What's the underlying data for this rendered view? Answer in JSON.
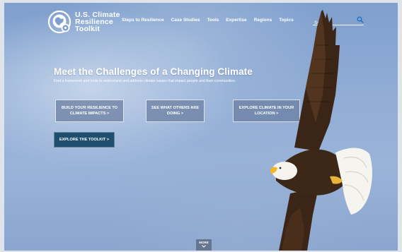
{
  "logo": {
    "line1": "U.S. Climate",
    "line2": "Resilience",
    "line3": "Toolkit"
  },
  "nav": {
    "items": [
      {
        "label": "Steps to Resilience"
      },
      {
        "label": "Case Studies"
      },
      {
        "label": "Tools"
      },
      {
        "label": "Expertise"
      },
      {
        "label": "Regions"
      },
      {
        "label": "Topics"
      }
    ]
  },
  "search": {
    "placeholder": "Search",
    "icon": "search-icon"
  },
  "hero": {
    "headline": "Meet the Challenges of a Changing Climate",
    "subline": "Find a framework and tools to understand and address climate issues that impact people and their communities.",
    "cta_buttons": [
      {
        "label": "BUILD YOUR RESILIENCE TO CLIMATE IMPACTS >"
      },
      {
        "label": "SEE WHAT OTHERS ARE DOING >"
      },
      {
        "label": "EXPLORE CLIMATE IN YOUR LOCATION >"
      }
    ],
    "explore_label": "EXPLORE THE TOOLKIT >"
  },
  "more": {
    "label": "MORE",
    "icon": "chevron-down-icon"
  },
  "colors": {
    "explore_button": "#1f4e6e",
    "sky": "#8fabd4",
    "text": "#ffffff"
  }
}
